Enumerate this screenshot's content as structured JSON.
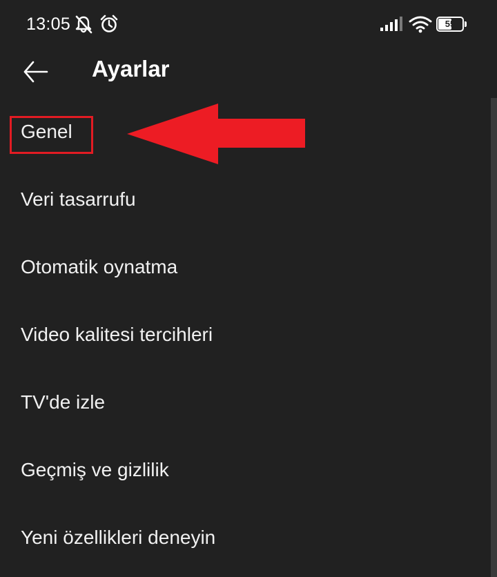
{
  "status_bar": {
    "time": "13:05",
    "battery_level": 55,
    "battery_text": "55",
    "icons": [
      "notifications-off-icon",
      "alarm-icon",
      "signal-icon",
      "wifi-icon",
      "battery-icon"
    ]
  },
  "header": {
    "back_icon": "arrow-left-icon",
    "title": "Ayarlar"
  },
  "settings": {
    "items": [
      {
        "label": "Genel"
      },
      {
        "label": "Veri tasarrufu"
      },
      {
        "label": "Otomatik oynatma"
      },
      {
        "label": "Video kalitesi tercihleri"
      },
      {
        "label": "TV'de izle"
      },
      {
        "label": "Geçmiş ve gizlilik"
      },
      {
        "label": "Yeni özellikleri deneyin"
      }
    ]
  },
  "annotation": {
    "highlighted_item": "Genel",
    "color": "#e21b23"
  },
  "colors": {
    "background": "#212121",
    "text": "#ffffff",
    "accent": "#e21b23"
  }
}
